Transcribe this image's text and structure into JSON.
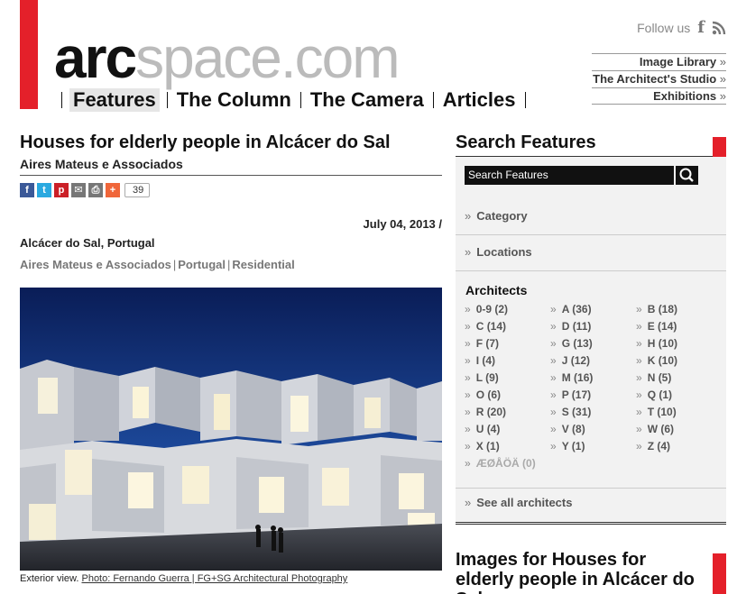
{
  "header": {
    "logo_bold": "arc",
    "logo_light": "space.com",
    "nav": [
      "Features",
      "The Column",
      "The Camera",
      "Articles"
    ],
    "follow_label": "Follow us",
    "toplinks": [
      "Image Library",
      "The Architect's Studio",
      "Exhibitions"
    ],
    "link_arrow": "»",
    "brand_red": "#e4202a"
  },
  "article": {
    "title": "Houses for elderly people in Alcácer do Sal",
    "byline": "Aires Mateus e Associados",
    "share_count": "39",
    "date": "July 04, 2013 /",
    "location": "Alcácer do Sal, Portugal",
    "tags": [
      "Aires Mateus e Associados",
      "Portugal",
      "Residential"
    ],
    "caption_prefix": "Exterior view.",
    "caption_credit": "Photo: Fernando Guerra | FG+SG Architectural Photography"
  },
  "sidebar": {
    "title": "Search Features",
    "search_placeholder": "Search Features",
    "facets": [
      "Category",
      "Locations"
    ],
    "architects_title": "Architects",
    "architects": [
      "0-9 (2)",
      "A (36)",
      "B (18)",
      "C (14)",
      "D (11)",
      "E (14)",
      "F (7)",
      "G (13)",
      "H (10)",
      "I (4)",
      "J (12)",
      "K (10)",
      "L (9)",
      "M (16)",
      "N (5)",
      "O (6)",
      "P (17)",
      "Q (1)",
      "R (20)",
      "S (31)",
      "T (10)",
      "U (4)",
      "V (8)",
      "W (6)",
      "X (1)",
      "Y (1)",
      "Z (4)",
      "ÆØÅÖÄ (0)"
    ],
    "see_all": "See all architects",
    "images_title": "Images for Houses for elderly people in Alcácer do Sal"
  }
}
